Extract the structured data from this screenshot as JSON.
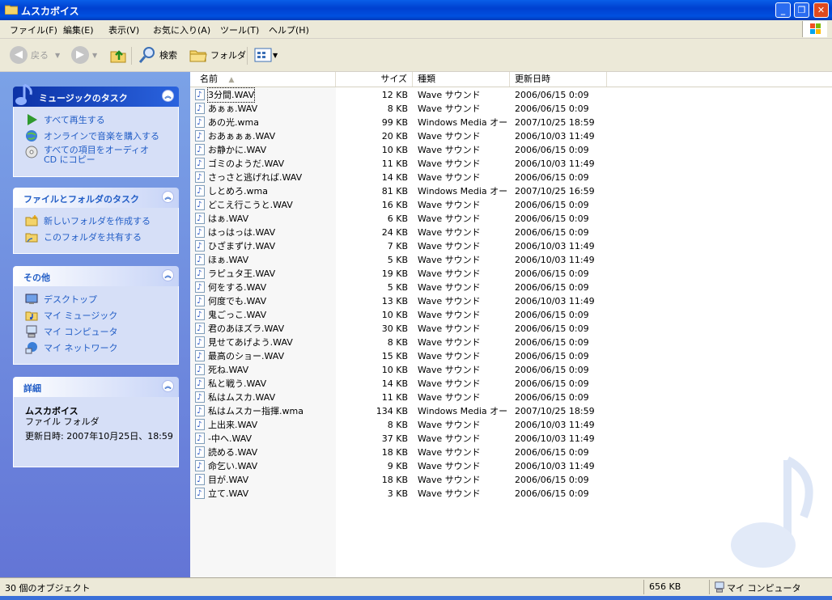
{
  "window": {
    "title": "ムスカボイス"
  },
  "menu": [
    "ファイル(F)",
    "編集(E)",
    "表示(V)",
    "お気に入り(A)",
    "ツール(T)",
    "ヘルプ(H)"
  ],
  "toolbar": {
    "back": "戻る",
    "search": "検索",
    "folders": "フォルダ"
  },
  "sidebar": {
    "music_tasks": {
      "title": "ミュージックのタスク",
      "items": [
        "すべて再生する",
        "オンラインで音楽を購入する",
        "すべての項目をオーディオ CD にコピー"
      ]
    },
    "file_tasks": {
      "title": "ファイルとフォルダのタスク",
      "items": [
        "新しいフォルダを作成する",
        "このフォルダを共有する"
      ]
    },
    "other": {
      "title": "その他",
      "items": [
        "デスクトップ",
        "マイ ミュージック",
        "マイ コンピュータ",
        "マイ ネットワーク"
      ]
    },
    "details": {
      "title": "詳細",
      "name": "ムスカボイス",
      "type": "ファイル フォルダ",
      "modified": "更新日時: 2007年10月25日、18:59"
    }
  },
  "columns": {
    "name": "名前",
    "size": "サイズ",
    "type": "種類",
    "modified": "更新日時"
  },
  "files": [
    {
      "name": "3分間.WAV",
      "size": "12 KB",
      "type": "Wave サウンド",
      "modified": "2006/06/15 0:09"
    },
    {
      "name": "あぁぁ.WAV",
      "size": "8 KB",
      "type": "Wave サウンド",
      "modified": "2006/06/15 0:09"
    },
    {
      "name": "あの光.wma",
      "size": "99 KB",
      "type": "Windows Media オー...",
      "modified": "2007/10/25 18:59"
    },
    {
      "name": "おあぁぁぁ.WAV",
      "size": "20 KB",
      "type": "Wave サウンド",
      "modified": "2006/10/03 11:49"
    },
    {
      "name": "お静かに.WAV",
      "size": "10 KB",
      "type": "Wave サウンド",
      "modified": "2006/06/15 0:09"
    },
    {
      "name": "ゴミのようだ.WAV",
      "size": "11 KB",
      "type": "Wave サウンド",
      "modified": "2006/10/03 11:49"
    },
    {
      "name": "さっさと逃げれば.WAV",
      "size": "14 KB",
      "type": "Wave サウンド",
      "modified": "2006/06/15 0:09"
    },
    {
      "name": "しとめろ.wma",
      "size": "81 KB",
      "type": "Windows Media オー...",
      "modified": "2007/10/25 16:59"
    },
    {
      "name": "どこえ行こうと.WAV",
      "size": "16 KB",
      "type": "Wave サウンド",
      "modified": "2006/06/15 0:09"
    },
    {
      "name": "はぁ.WAV",
      "size": "6 KB",
      "type": "Wave サウンド",
      "modified": "2006/06/15 0:09"
    },
    {
      "name": "はっはっは.WAV",
      "size": "24 KB",
      "type": "Wave サウンド",
      "modified": "2006/06/15 0:09"
    },
    {
      "name": "ひざまずけ.WAV",
      "size": "7 KB",
      "type": "Wave サウンド",
      "modified": "2006/10/03 11:49"
    },
    {
      "name": "ほぁ.WAV",
      "size": "5 KB",
      "type": "Wave サウンド",
      "modified": "2006/10/03 11:49"
    },
    {
      "name": "ラピュタ王.WAV",
      "size": "19 KB",
      "type": "Wave サウンド",
      "modified": "2006/06/15 0:09"
    },
    {
      "name": "何をする.WAV",
      "size": "5 KB",
      "type": "Wave サウンド",
      "modified": "2006/06/15 0:09"
    },
    {
      "name": "何度でも.WAV",
      "size": "13 KB",
      "type": "Wave サウンド",
      "modified": "2006/10/03 11:49"
    },
    {
      "name": "鬼ごっこ.WAV",
      "size": "10 KB",
      "type": "Wave サウンド",
      "modified": "2006/06/15 0:09"
    },
    {
      "name": "君のあほズラ.WAV",
      "size": "30 KB",
      "type": "Wave サウンド",
      "modified": "2006/06/15 0:09"
    },
    {
      "name": "見せてあげよう.WAV",
      "size": "8 KB",
      "type": "Wave サウンド",
      "modified": "2006/06/15 0:09"
    },
    {
      "name": "最高のショー.WAV",
      "size": "15 KB",
      "type": "Wave サウンド",
      "modified": "2006/06/15 0:09"
    },
    {
      "name": "死ね.WAV",
      "size": "10 KB",
      "type": "Wave サウンド",
      "modified": "2006/06/15 0:09"
    },
    {
      "name": "私と戦う.WAV",
      "size": "14 KB",
      "type": "Wave サウンド",
      "modified": "2006/06/15 0:09"
    },
    {
      "name": "私はムスカ.WAV",
      "size": "11 KB",
      "type": "Wave サウンド",
      "modified": "2006/06/15 0:09"
    },
    {
      "name": "私はムスカー指揮.wma",
      "size": "134 KB",
      "type": "Windows Media オー...",
      "modified": "2007/10/25 18:59"
    },
    {
      "name": "上出来.WAV",
      "size": "8 KB",
      "type": "Wave サウンド",
      "modified": "2006/10/03 11:49"
    },
    {
      "name": "-中へ.WAV",
      "size": "37 KB",
      "type": "Wave サウンド",
      "modified": "2006/10/03 11:49"
    },
    {
      "name": "読める.WAV",
      "size": "18 KB",
      "type": "Wave サウンド",
      "modified": "2006/06/15 0:09"
    },
    {
      "name": "命乞い.WAV",
      "size": "9 KB",
      "type": "Wave サウンド",
      "modified": "2006/10/03 11:49"
    },
    {
      "name": "目が.WAV",
      "size": "18 KB",
      "type": "Wave サウンド",
      "modified": "2006/06/15 0:09"
    },
    {
      "name": "立て.WAV",
      "size": "3 KB",
      "type": "Wave サウンド",
      "modified": "2006/06/15 0:09"
    }
  ],
  "status": {
    "objects": "30 個のオブジェクト",
    "size": "656 KB",
    "location": "マイ コンピュータ"
  }
}
